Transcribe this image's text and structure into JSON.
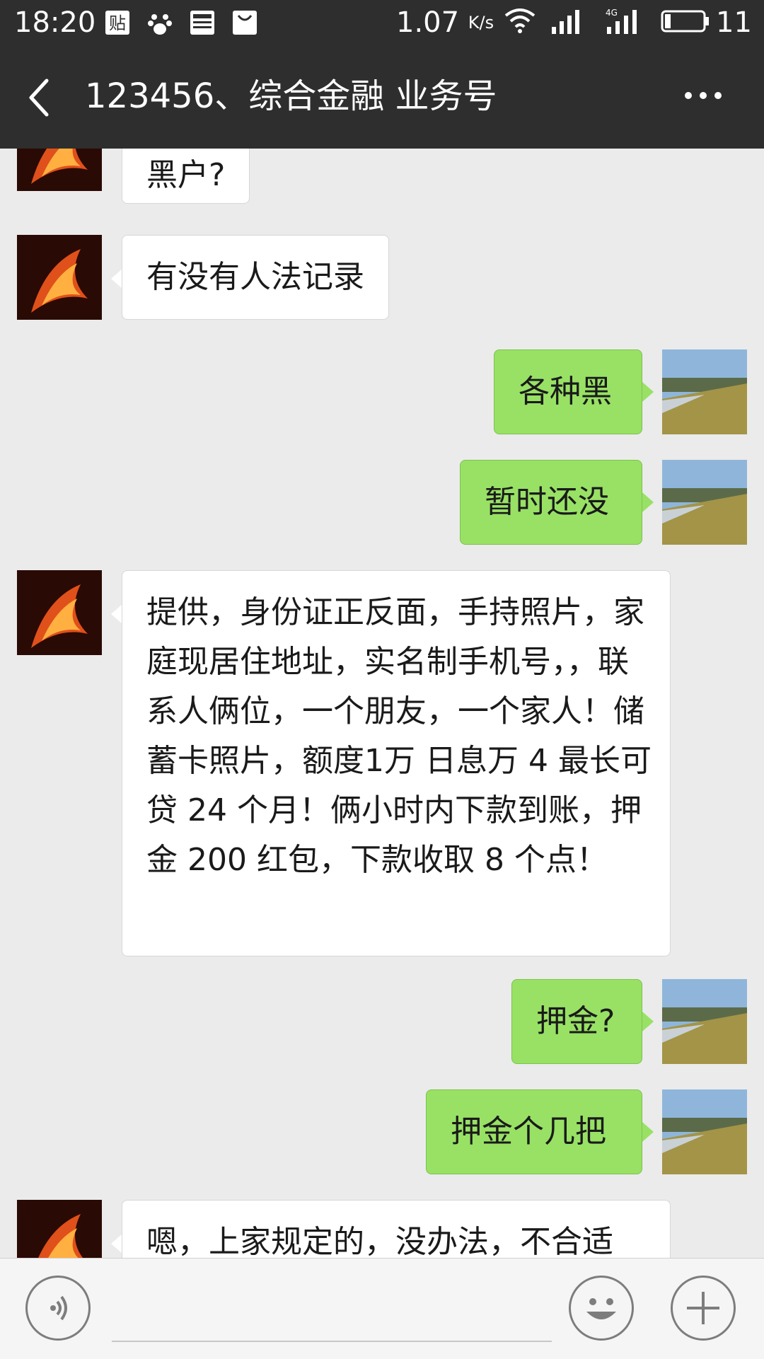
{
  "status_bar": {
    "time": "18:20",
    "speed": "1.07",
    "speed_unit": "K/s",
    "battery": "11",
    "icons": [
      "tieba-icon",
      "baidu-paw-icon",
      "news-icon",
      "shopping-bag-icon",
      "wifi-icon",
      "signal-icon",
      "signal-4g-icon",
      "battery-icon"
    ]
  },
  "header": {
    "title": "123456、综合金融 业务号",
    "back_icon": "back-arrow-icon",
    "more_icon": "more-dots-icon"
  },
  "messages": [
    {
      "side": "left",
      "text": "黑户?"
    },
    {
      "side": "left",
      "text": "有没有人法记录"
    },
    {
      "side": "right",
      "text": "各种黑"
    },
    {
      "side": "right",
      "text": "暂时还没"
    },
    {
      "side": "left",
      "text": "提供，身份证正反面，手持照片，家庭现居住地址，实名制手机号，，联系人俩位，一个朋友，一个家人！储蓄卡照片，额度1万 日息万 4 最长可贷 24 个月！俩小时内下款到账，押金 200 红包，下款收取 8 个点！"
    },
    {
      "side": "right",
      "text": "押金?"
    },
    {
      "side": "right",
      "text": "押金个几把"
    },
    {
      "side": "left",
      "text": "嗯，上家规定的，没办法，不合适"
    }
  ],
  "input_bar": {
    "voice_icon": "voice-icon",
    "emoji_icon": "emoji-icon",
    "plus_icon": "plus-icon"
  },
  "colors": {
    "bar_bg": "#2e2e2e",
    "chat_bg": "#ebebeb",
    "bubble_mine": "#98e165",
    "bubble_theirs": "#ffffff"
  }
}
